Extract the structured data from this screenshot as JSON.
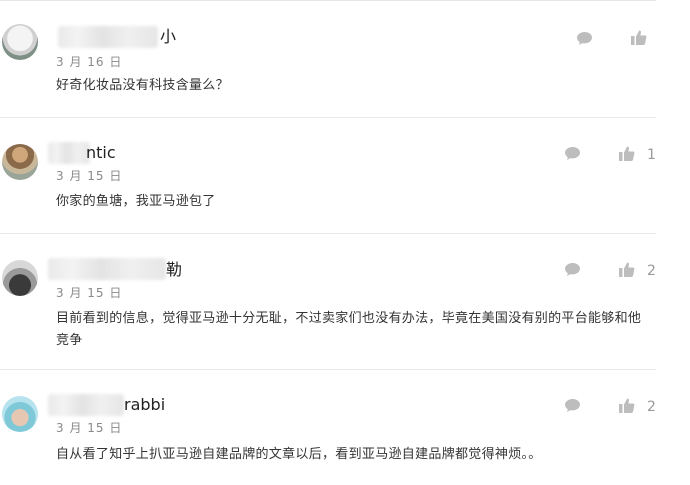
{
  "comments": [
    {
      "name_suffix": "小",
      "date": "3 月 16 日",
      "text": "好奇化妆品没有科技含量么？",
      "likes": ""
    },
    {
      "name_suffix": "ntic",
      "date": "3 月 15 日",
      "text": "你家的鱼塘，我亚马逊包了",
      "likes": "1"
    },
    {
      "name_suffix": "勒",
      "date": "3 月 15 日",
      "text": "目前看到的信息，觉得亚马逊十分无耻，不过卖家们也没有办法，毕竟在美国没有别的平台能够和他竞争",
      "likes": "2"
    },
    {
      "name_suffix": "rabbi",
      "date": "3 月 15 日",
      "text": "自从看了知乎上扒亚马逊自建品牌的文章以后，看到亚马逊自建品牌都觉得神烦。。",
      "likes": "2"
    }
  ],
  "icons": {
    "reply": "comment-bubble-icon",
    "like": "thumbs-up-icon"
  },
  "colors": {
    "icon": "#bdbdbd",
    "date": "#8a8a8a",
    "text": "#333333",
    "divider": "#e8e8e8"
  }
}
